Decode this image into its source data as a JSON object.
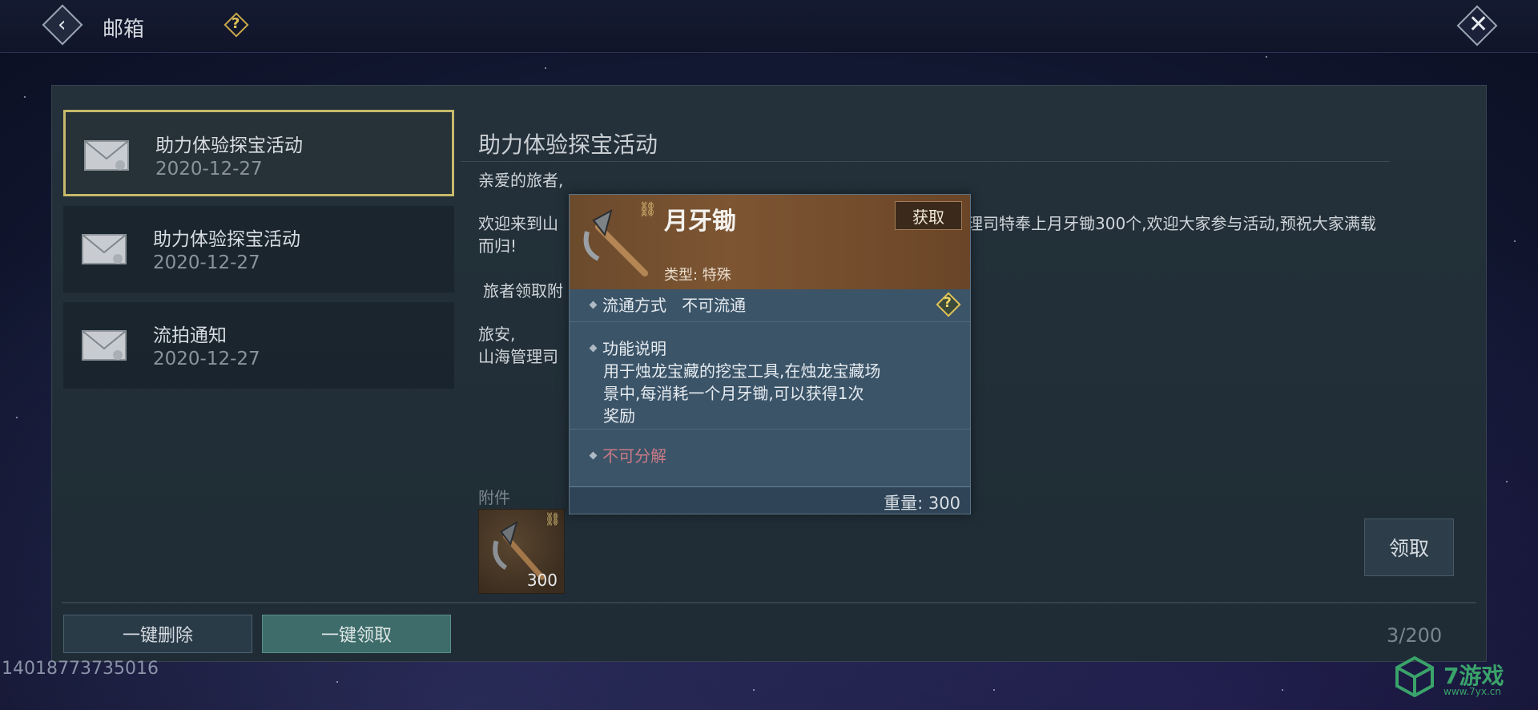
{
  "header": {
    "title": "邮箱"
  },
  "mails": [
    {
      "title": "助力体验探宝活动",
      "date": "2020-12-27"
    },
    {
      "title": "助力体验探宝活动",
      "date": "2020-12-27"
    },
    {
      "title": "流拍通知",
      "date": "2020-12-27"
    }
  ],
  "detail": {
    "title": "助力体验探宝活动",
    "greeting": "亲爱的旅者,",
    "line1_left": "欢迎来到山",
    "line1_right": "理司特奉上月牙锄300个,欢迎大家参与活动,预祝大家满载",
    "line2": "而归!",
    "line3": "旅者领取附",
    "line4": "旅安,",
    "line5": "山海管理司",
    "attachments_label": "附件",
    "attachment_count": "300",
    "claim_label": "领取"
  },
  "footer": {
    "delete_all": "一键删除",
    "claim_all": "一键领取",
    "counter": "3/200"
  },
  "uid": "14018773735016",
  "watermark": {
    "brand": "7游戏",
    "url": "www.7yx.cn"
  },
  "tooltip": {
    "name": "月牙锄",
    "get_label": "获取",
    "type": "类型: 特殊",
    "circulation_label": "流通方式",
    "circulation_value": "不可流通",
    "function_label": "功能说明",
    "function_lines": [
      "用于烛龙宝藏的挖宝工具,在烛龙宝藏场",
      "景中,每消耗一个月牙锄,可以获得1次",
      "奖励"
    ],
    "not_decomposable": "不可分解",
    "weight": "重量: 300"
  },
  "colors": {
    "accent_gold": "#c8b96a",
    "claim_all_bg": "#3d6c6a",
    "not_decomposable": "#c97a86"
  }
}
